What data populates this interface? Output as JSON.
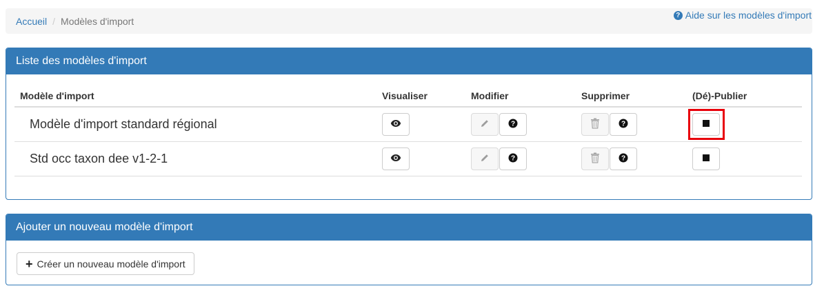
{
  "breadcrumb": {
    "home": "Accueil",
    "separator": "/",
    "current": "Modèles d'import"
  },
  "help_link": {
    "label": "Aide sur les modèles d'import",
    "icon": "question-circle-icon"
  },
  "list_panel": {
    "title": "Liste des modèles d'import",
    "columns": {
      "name": "Modèle d'import",
      "view": "Visualiser",
      "edit": "Modifier",
      "delete": "Supprimer",
      "publish": "(Dé)-Publier"
    },
    "rows": [
      {
        "name": "Modèle d'import standard régional",
        "highlighted": true
      },
      {
        "name": "Std occ taxon dee v1-2-1",
        "highlighted": false
      }
    ]
  },
  "add_panel": {
    "title": "Ajouter un nouveau modèle d'import",
    "create_label": "Créer un nouveau modèle d'import",
    "create_icon": "plus-icon"
  },
  "colors": {
    "primary": "#337ab7",
    "highlight": "#e8000b"
  }
}
